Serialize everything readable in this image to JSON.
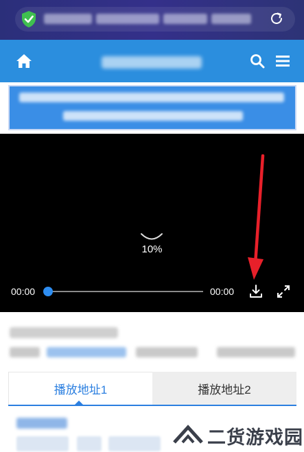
{
  "player": {
    "loading_text": "10%",
    "progress_fraction": 0.0,
    "current_time": "00:00",
    "duration": "00:00"
  },
  "tabs": [
    {
      "label": "播放地址1",
      "active": true
    },
    {
      "label": "播放地址2",
      "active": false
    }
  ],
  "watermark": {
    "text": "二货游戏园"
  },
  "colors": {
    "browser_bar": "#2b2f7a",
    "site_header": "#2b8ede",
    "notice_bg": "#3a8ee6",
    "accent": "#2b7fe0",
    "annotation_arrow": "#e8202a",
    "shield": "#3fbf4f"
  },
  "icons": {
    "address_bar_security": "shield-check-icon",
    "address_bar_reload": "reload-icon",
    "header_home": "home-icon",
    "header_search": "search-icon",
    "header_menu": "hamburger-menu-icon",
    "player_download": "download-icon",
    "player_fullscreen": "fullscreen-icon",
    "annotation": "red-arrow-annotation"
  }
}
